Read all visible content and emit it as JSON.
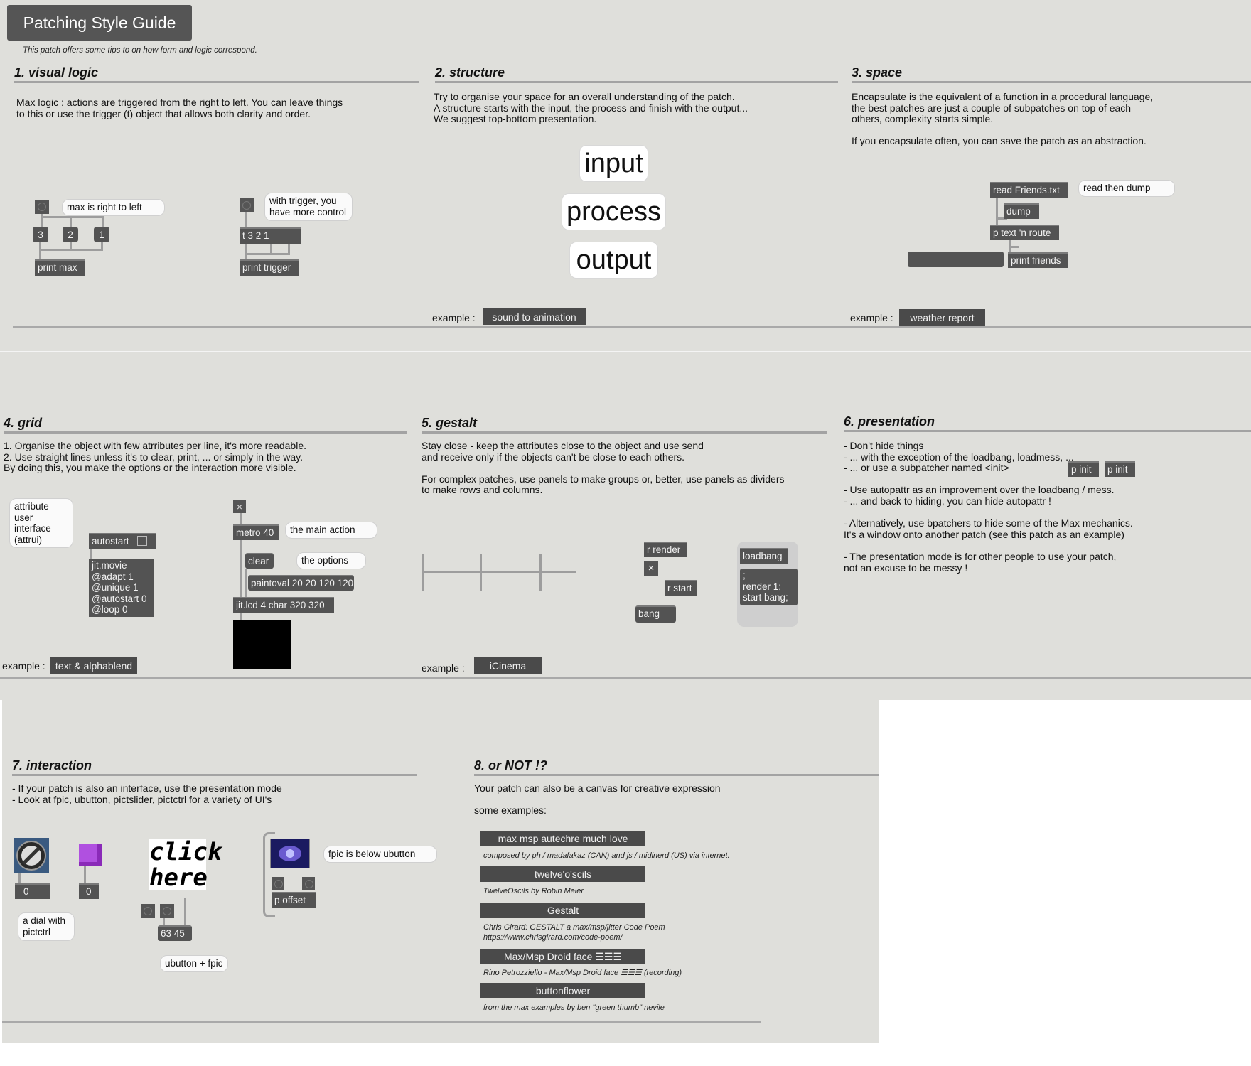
{
  "window": {
    "title": "Patching Style Guide",
    "subtitle": "This patch offers some tips to on how form and logic correspond."
  },
  "section1": {
    "heading": "1. visual logic",
    "body": "Max logic : actions are triggered from the right to left. You can leave things\nto this or use the trigger (t) object that allows both clarity and order.",
    "left": {
      "bubble": "max is right to left",
      "n3": "3",
      "n2": "2",
      "n1": "1",
      "print": "print max"
    },
    "right": {
      "bubble": "with trigger, you\nhave more control",
      "trigger": "t 3 2 1",
      "print": "print trigger"
    }
  },
  "section2": {
    "heading": "2. structure",
    "body": "Try to organise your space for an overall understanding of the patch.\nA structure starts with the input, the process and finish with the output...\nWe suggest top-bottom presentation.",
    "flow": [
      "input",
      "process",
      "output"
    ],
    "example_label": "example :",
    "example_button": "sound to animation"
  },
  "section3": {
    "heading": "3. space",
    "body": "Encapsulate is the equivalent of a function in a procedural language,\nthe best patches are just a couple of subpatches on top of each\nothers, complexity starts simple.\n\nIf you encapsulate often, you can save the patch as an abstraction.",
    "read": "read Friends.txt",
    "bubble": "read then dump",
    "dump": "dump",
    "route": "p text 'n route",
    "print": "print friends",
    "example_label": "example :",
    "example_button": "weather report"
  },
  "section4": {
    "heading": "4. grid",
    "body": "1. Organise the object with few atrributes per line, it's more readable.\n2. Use straight lines unless it's to clear, print, ... or simply in the way.\nBy doing this, you make the options or the interaction more visible.",
    "bubble": "attribute\nuser\ninterface\n(attrui)",
    "autostart": "autostart",
    "jit": "jit.movie\n@adapt 1\n@unique 1\n@autostart 0\n@loop 0",
    "metro": "metro 40",
    "metro_bubble": "the main action",
    "clear": "clear",
    "clear_bubble": "the options",
    "paintoval": "paintoval 20 20 120 120",
    "lcd": "jit.lcd 4 char 320 320",
    "example_label": "example :",
    "example_button": "text & alphablend"
  },
  "section5": {
    "heading": "5. gestalt",
    "body": "Stay close - keep the attributes close to the object and use send\nand receive only if the objects can't be close to each others.\n\nFor complex patches, use panels to make groups or, better, use panels as dividers\nto make rows and columns.",
    "rrender": "r render",
    "rstart": "r start",
    "bang": "bang",
    "loadbang": "loadbang",
    "msg": ";\nrender 1;\nstart bang;",
    "example_label": "example :",
    "example_button": "iCinema"
  },
  "section6": {
    "heading": "6. presentation",
    "body": "- Don't hide things\n- ... with the exception of the loadbang, loadmess, ...\n- ... or use a subpatcher named <init>\n\n- Use autopattr as an improvement over the loadbang / mess.\n- ... and back to hiding, you can hide autopattr !\n\n- Alternatively, use bpatchers to hide some of the Max mechanics.\nIt's a window onto another patch (see this patch as an example)\n\n- The presentation mode is for other people to use your patch,\nnot an excuse to be messy !",
    "pinit1": "p init",
    "pinit2": "p init"
  },
  "section7": {
    "heading": "7. interaction",
    "body": "- If your patch is also an interface, use the presentation mode\n- Look at fpic, ubutton, pictslider, pictctrl for a variety of UI's",
    "num_left": "0",
    "num_mid": "0",
    "dial_bubble": "a dial with\npictctrl",
    "click": "click\nhere",
    "coords": "63 45",
    "ubutton_bubble": "ubutton + fpic",
    "fpic_bubble": "fpic is below ubutton",
    "poffset": "p offset"
  },
  "section8": {
    "heading": "8. or NOT !?",
    "body": "Your patch can also be a canvas for creative expression",
    "some": "some examples:",
    "items": [
      {
        "label": "max msp autechre much love",
        "caption": "composed by ph / madafakaz (CAN) and js / midinerd (US) via internet."
      },
      {
        "label": "twelve'o'scils",
        "caption": "TwelveOscils by Robin Meier"
      },
      {
        "label": "Gestalt",
        "caption": "Chris Girard: GESTALT a max/msp/jitter Code Poem\nhttps://www.chrisgirard.com/code-poem/"
      },
      {
        "label": "Max/Msp Droid face ☰☰☰",
        "caption": "Rino Petrozziello - Max/Msp Droid face ☰☰☰ (recording)"
      },
      {
        "label": "buttonflower",
        "caption": "from the max examples by ben \"green thumb\" nevile"
      }
    ]
  },
  "colors": {
    "panel": "#dfdfdb",
    "object": "#535353",
    "button": "#4a4a4a"
  }
}
